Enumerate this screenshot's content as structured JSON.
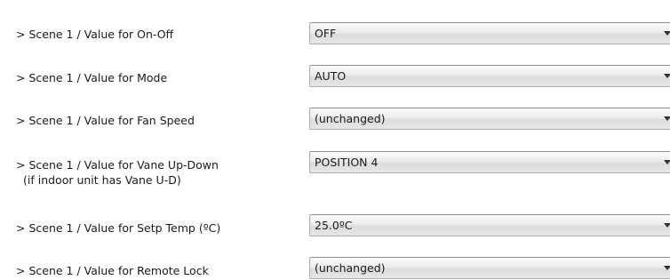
{
  "rows": [
    {
      "label": "> Scene 1 / Value for On-Off",
      "sub": "",
      "value": "OFF"
    },
    {
      "label": "> Scene 1 / Value for Mode",
      "sub": "",
      "value": "AUTO"
    },
    {
      "label": "> Scene 1 / Value for Fan Speed",
      "sub": "",
      "value": "(unchanged)"
    },
    {
      "label": "> Scene 1 / Value for Vane Up-Down",
      "sub": "(if indoor unit has Vane U-D)",
      "value": "POSITION 4"
    },
    {
      "label": "> Scene 1 / Value for Setp Temp (ºC)",
      "sub": "",
      "value": "25.0ºC"
    },
    {
      "label": "> Scene 1 / Value for Remote Lock",
      "sub": "",
      "value": "(unchanged)"
    }
  ],
  "icons": {
    "dropdown": "chevron-down-icon"
  }
}
